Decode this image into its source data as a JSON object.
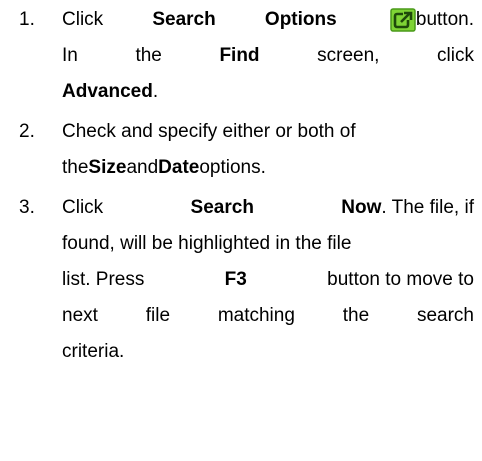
{
  "steps": [
    {
      "number": "1.",
      "lines": [
        [
          "Click",
          "Search",
          "Options",
          "button."
        ],
        [
          "In",
          "the",
          "Find",
          "screen,",
          "click"
        ],
        [
          "Advanced",
          "."
        ]
      ],
      "icon": "search-options-icon"
    },
    {
      "number": "2.",
      "lines": [
        [
          "Check and specify either or both of"
        ],
        [
          "the",
          "Size",
          "and",
          "Date",
          "options."
        ]
      ]
    },
    {
      "number": "3.",
      "lines": [
        [
          "Click",
          "Search",
          "Now",
          ". The file, if"
        ],
        [
          "found, will be highlighted in the file"
        ],
        [
          "list. Press",
          "F3",
          "button to move to"
        ],
        [
          "next",
          "file",
          "matching",
          "the",
          "search"
        ],
        [
          "criteria."
        ]
      ]
    }
  ],
  "colors": {
    "icon_fill": "#7fd435",
    "icon_border": "#4a9a1a",
    "icon_glyph": "#1f4a0a"
  }
}
